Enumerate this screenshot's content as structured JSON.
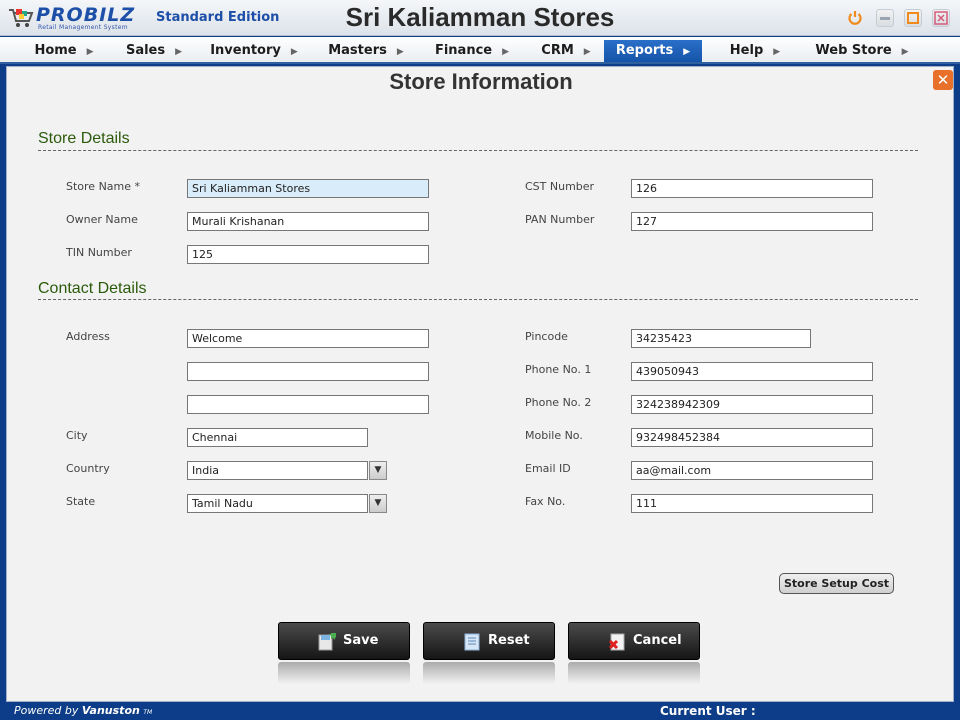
{
  "app": {
    "brand": "PROBILZ",
    "brand_tagline": "Retail Management System",
    "edition": "Standard Edition",
    "store_title": "Sri Kaliamman Stores"
  },
  "menu": [
    {
      "label": "Home"
    },
    {
      "label": "Sales"
    },
    {
      "label": "Inventory"
    },
    {
      "label": "Masters"
    },
    {
      "label": "Finance"
    },
    {
      "label": "CRM"
    },
    {
      "label": "Reports",
      "active": true
    },
    {
      "label": "Help"
    },
    {
      "label": "Web Store"
    }
  ],
  "page": {
    "title": "Store Information",
    "store_section": "Store Details",
    "contact_section": "Contact Details"
  },
  "store": {
    "store_name_label": "Store Name *",
    "store_name": "Sri Kaliamman Stores",
    "owner_name_label": "Owner Name",
    "owner_name": "Murali Krishanan",
    "tin_label": "TIN Number",
    "tin": "125",
    "cst_label": "CST Number",
    "cst": "126",
    "pan_label": "PAN Number",
    "pan": "127"
  },
  "contact": {
    "address_label": "Address",
    "address1": "Welcome",
    "address2": "",
    "address3": "",
    "city_label": "City",
    "city": "Chennai",
    "country_label": "Country",
    "country": "India",
    "state_label": "State",
    "state": "Tamil Nadu",
    "pincode_label": "Pincode",
    "pincode": "34235423",
    "phone1_label": "Phone No. 1",
    "phone1": "439050943",
    "phone2_label": "Phone No. 2",
    "phone2": "324238942309",
    "mobile_label": "Mobile No.",
    "mobile": "932498452384",
    "email_label": "Email ID",
    "email": "aa@mail.com",
    "fax_label": "Fax No.",
    "fax": "111"
  },
  "buttons": {
    "setup_cost": "Store Setup Cost",
    "save": "Save",
    "reset": "Reset",
    "cancel": "Cancel"
  },
  "status": {
    "powered_prefix": "Powered by",
    "powered_brand": "Vanuston",
    "powered_tm": "TM",
    "current_user": "Current User :"
  },
  "colors": {
    "accent": "#1554a8",
    "section_title": "#2c5b0c",
    "close_orange": "#e8702a"
  }
}
